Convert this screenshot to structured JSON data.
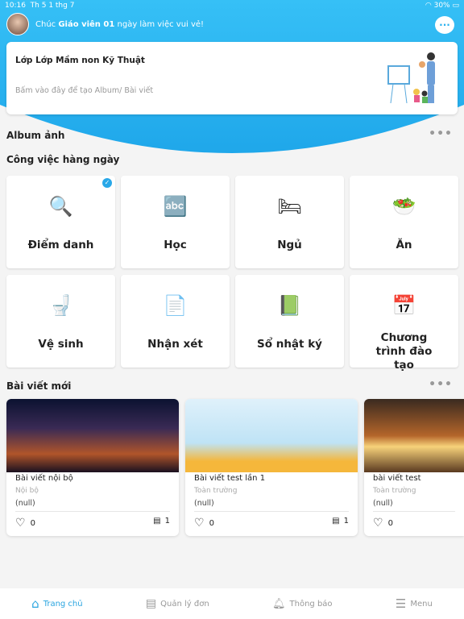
{
  "status": {
    "time": "10:16",
    "date": "Th 5 1 thg 7",
    "battery": "30%"
  },
  "greeting": {
    "prefix": "Chúc ",
    "name": "Giáo viên 01",
    "suffix": " ngày làm việc vui vẻ!"
  },
  "class_card": {
    "title": "Lớp Lớp Mầm non Kỹ Thuật",
    "hint": "Bấm vào đây để tạo Album/ Bài viết"
  },
  "album": {
    "title": "Album ảnh"
  },
  "daily": {
    "title": "Công việc hàng ngày",
    "items": [
      {
        "label": "Điểm danh",
        "icon": "magnifier-child-icon",
        "emoji": "🔍",
        "checked": true
      },
      {
        "label": "Học",
        "icon": "abc-board-icon",
        "emoji": "🔤"
      },
      {
        "label": "Ngủ",
        "icon": "bed-icon",
        "emoji": "🛏"
      },
      {
        "label": "Ăn",
        "icon": "food-bowl-icon",
        "emoji": "🥗"
      },
      {
        "label": "Vệ sinh",
        "icon": "toilet-icon",
        "emoji": "🚽"
      },
      {
        "label": "Nhận xét",
        "icon": "note-icon",
        "emoji": "📄"
      },
      {
        "label": "Sổ nhật ký",
        "icon": "diary-icon",
        "emoji": "📗"
      },
      {
        "label": "Chương trình đào tạo",
        "icon": "calendar-icon",
        "emoji": "📅"
      }
    ]
  },
  "posts": {
    "title": "Bài viết mới",
    "items": [
      {
        "title": "Bài viết nội bộ",
        "audience": "Nội bộ",
        "note": "(null)",
        "likes": "0",
        "comments": "1"
      },
      {
        "title": "Bài viết test lần 1",
        "audience": "Toàn trường",
        "note": "(null)",
        "likes": "0",
        "comments": "1"
      },
      {
        "title": "bài viết test",
        "audience": "Toàn trường",
        "note": "(null)",
        "likes": "0"
      }
    ]
  },
  "nav": [
    {
      "label": "Trang chủ",
      "active": true
    },
    {
      "label": "Quản lý đơn"
    },
    {
      "label": "Thông báo"
    },
    {
      "label": "Menu"
    }
  ],
  "colors": {
    "primary": "#29b1ef",
    "active": "#2aa5e0"
  }
}
